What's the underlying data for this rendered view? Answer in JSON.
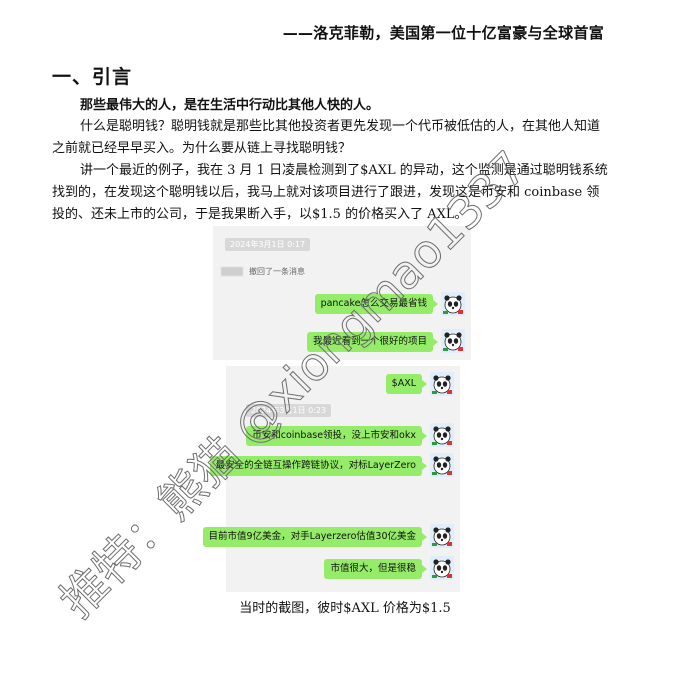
{
  "quote": "——洛克菲勒，美国第一位十亿富豪与全球首富",
  "section_title": "一、引言",
  "bold_statement": "那些最伟大的人，是在生活中行动比其他人快的人。",
  "paragraph1": "什么是聪明钱？聪明钱就是那些比其他投资者更先发现一个代币被低估的人，在其他人知道之前就已经早早买入。为什么要从链上寻找聪明钱？",
  "paragraph2": "讲一个最近的例子，我在 3 月 1 日凌晨检测到了$AXL 的异动，这个监测是通过聪明钱系统找到的，在发现这个聪明钱以后，我马上就对该项目进行了跟进，发现这是币安和 coinbase 领投的、还未上市的公司，于是我果断入手，以$1.5 的价格买入了 AXL。",
  "chat1": {
    "timestamp": "2024年3月1日 0:17",
    "recall_text": "撤回了一条消息",
    "messages": [
      "pancake怎么交易最省钱",
      "我最近看到一个很好的项目"
    ]
  },
  "chat2": {
    "timestamp": "2024年3月1日 0:23",
    "messages": [
      "$AXL",
      "币安和coinbase领投，没上市安和okx",
      "最安全的全链互操作跨链协议，对标LayerZero",
      "目前市值9亿美金，对手Layerzero估值30亿美金",
      "市值很大，但是很稳"
    ]
  },
  "caption": "当时的截图，彼时$AXL 价格为$1.5",
  "watermark": "推特：熊猫 @xiongmao1337",
  "colors": {
    "bubble": "#95ec69",
    "chat_bg": "#f2f2f2",
    "watermark": "#6e6e6e"
  },
  "icons": {
    "avatar": "panda-avatar-icon"
  }
}
